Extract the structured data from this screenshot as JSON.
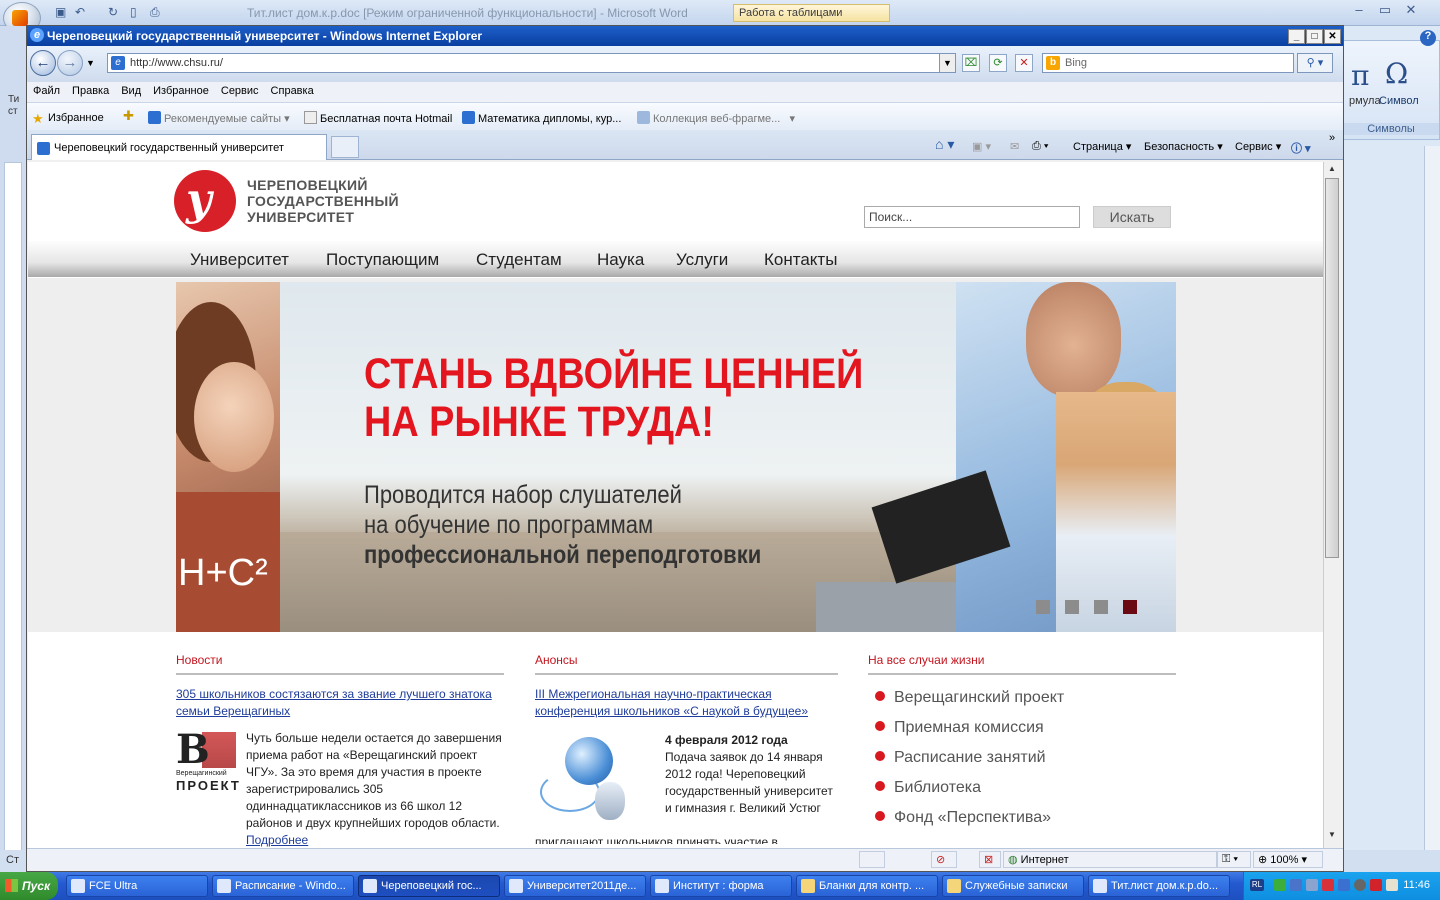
{
  "word": {
    "title": "Тит.лист дом.к.р.doc [Режим ограниченной функциональности] - Microsoft Word",
    "table_tools": "Работа с таблицами",
    "left_label": "Ти\nст",
    "ribbon": {
      "formula_label": "рмула",
      "symbol_label": "Символ",
      "group_label": "Символы"
    },
    "status_left": "Ст"
  },
  "ie": {
    "title": "Череповецкий государственный университет - Windows Internet Explorer",
    "address": "http://www.chsu.ru/",
    "search_placeholder": "Bing",
    "menu": [
      "Файл",
      "Правка",
      "Вид",
      "Избранное",
      "Сервис",
      "Справка"
    ],
    "favorites": {
      "label": "Избранное",
      "items": [
        "Рекомендуемые сайты",
        "Бесплатная почта Hotmail",
        "Математика дипломы, кур...",
        "Коллекция веб-фрагме..."
      ]
    },
    "tab_label": "Череповецкий государственный университет",
    "commands": [
      "Страница",
      "Безопасность",
      "Сервис"
    ],
    "status": {
      "zone": "Интернет",
      "zoom": "100%"
    }
  },
  "site": {
    "logo_lines": [
      "ЧЕРЕПОВЕЦКИЙ",
      "ГОСУДАРСТВЕННЫЙ",
      "УНИВЕРСИТЕТ"
    ],
    "search_placeholder": "Поиск...",
    "search_button": "Искать",
    "nav": [
      "Университет",
      "Поступающим",
      "Студентам",
      "Наука",
      "Услуги",
      "Контакты"
    ],
    "banner": {
      "headline1": "СТАНЬ ВДВОЙНЕ ЦЕННЕЙ",
      "headline2": "НА РЫНКЕ ТРУДА!",
      "sub1": "Проводится набор слушателей",
      "sub2": "на обучение по программам",
      "sub3": "профессиональной переподготовки",
      "chem": "H+C²",
      "slide_count": 4,
      "active_slide": 4
    },
    "news": {
      "heading": "Новости",
      "link": "305 школьников состязаются за звание лучшего знатока семьи Верещагиных",
      "logo_big": "В",
      "logo_small": "Верещагинский",
      "logo_word": "ПРОЕКТ",
      "text": "Чуть больше недели остается до завершения приема работ на «Верещагинский проект ЧГУ». За это время для участия в проекте зарегистрировались 305 одиннадцатиклассников из 66 школ 12 районов и двух крупнейших городов области.",
      "more": "Подробнее"
    },
    "announce": {
      "heading": "Анонсы",
      "link": "III Межрегиональная научно-практическая конференция школьников «С наукой в будущее»",
      "date": "4 февраля 2012 года",
      "text": "Подача заявок до 14 января 2012 года! Череповецкий государственный университет и гимназия г. Великий Устюг",
      "text2": "приглашают школьников принять участие в"
    },
    "life": {
      "heading": "На все случаи жизни",
      "items": [
        "Верещагинский проект",
        "Приемная комиссия",
        "Расписание занятий",
        "Библиотека",
        "Фонд «Перспектива»"
      ]
    }
  },
  "taskbar": {
    "start": "Пуск",
    "tasks": [
      "FCE Ultra",
      "Расписание - Windo...",
      "Череповецкий гос...",
      "Университет2011де...",
      "Институт : форма",
      "Бланки для контр. ...",
      "Служебные записки",
      "Тит.лист дом.к.р.do..."
    ],
    "lang": "RL",
    "clock": "11:46"
  },
  "colors": {
    "accent_red": "#d8181f",
    "xp_blue": "#245ad0",
    "ie_title": "#0a3fa0"
  }
}
